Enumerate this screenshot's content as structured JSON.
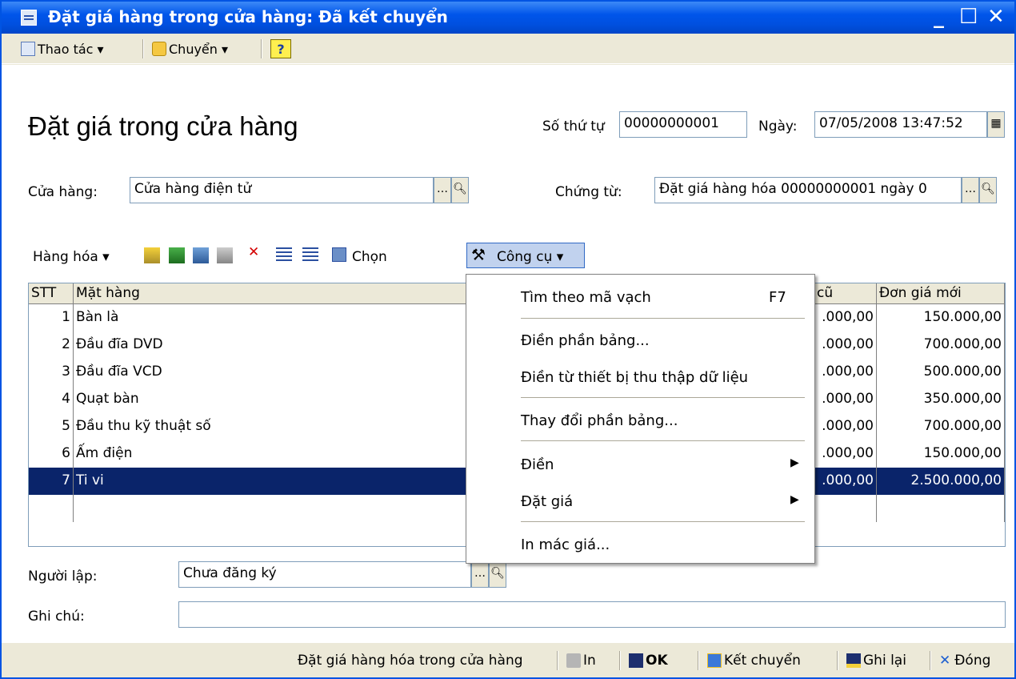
{
  "window": {
    "title": "Đặt giá hàng trong cửa hàng: Đã kết chuyển",
    "min": "_",
    "max": "☐",
    "close": "✕"
  },
  "toolbar": {
    "actions": "Thao tác ▾",
    "move": "Chuyển ▾",
    "help": "?"
  },
  "form": {
    "heading": "Đặt giá trong cửa hàng",
    "number_label": "Số thứ tự",
    "number_value": "00000000001",
    "date_label": "Ngày:",
    "date_value": "07/05/2008 13:47:52",
    "store_label": "Cửa hàng:",
    "store_value": "Cửa hàng điện tử",
    "doc_label": "Chứng từ:",
    "doc_value": "Đặt giá hàng hóa 00000000001 ngày 0",
    "creator_label": "Người lập:",
    "creator_value": "Chưa đăng ký",
    "note_label": "Ghi chú:",
    "note_value": ""
  },
  "grid_toolbar": {
    "goods": "Hàng hóa ▾",
    "choose": "Chọn",
    "tools": "Công cụ ▾"
  },
  "grid": {
    "columns": [
      "STT",
      "Mặt hàng",
      "cũ",
      "Đơn giá mới"
    ],
    "rows": [
      {
        "n": "1",
        "item": "Bàn là",
        "old": ".000,00",
        "new": "150.000,00"
      },
      {
        "n": "2",
        "item": "Đầu đĩa DVD",
        "old": ".000,00",
        "new": "700.000,00"
      },
      {
        "n": "3",
        "item": "Đầu đĩa VCD",
        "old": ".000,00",
        "new": "500.000,00"
      },
      {
        "n": "4",
        "item": "Quạt bàn",
        "old": ".000,00",
        "new": "350.000,00"
      },
      {
        "n": "5",
        "item": "Đầu thu kỹ thuật số",
        "old": ".000,00",
        "new": "700.000,00"
      },
      {
        "n": "6",
        "item": "Ấm điện",
        "old": ".000,00",
        "new": "150.000,00"
      },
      {
        "n": "7",
        "item": "Ti vi",
        "old": ".000,00",
        "new": "2.500.000,00"
      }
    ]
  },
  "menu": {
    "barcode": "Tìm theo mã vạch",
    "barcode_key": "F7",
    "fill_table": "Điền phần bảng...",
    "fill_device": "Điền từ thiết bị thu thập dữ liệu",
    "change_table": "Thay đổi phần bảng...",
    "fill": "Điền",
    "set_price": "Đặt giá",
    "print_tags": "In mác giá..."
  },
  "status": {
    "doc": "Đặt giá hàng hóa trong cửa hàng",
    "print": "In",
    "ok": "OK",
    "post": "Kết chuyển",
    "save": "Ghi lại",
    "close": "Đóng"
  }
}
